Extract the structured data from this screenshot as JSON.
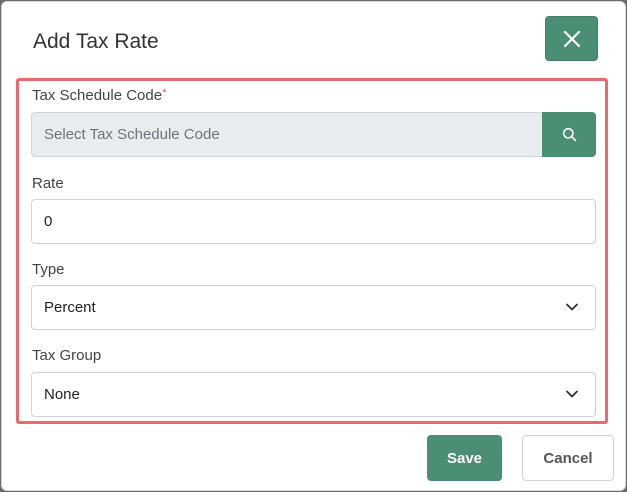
{
  "modal": {
    "title": "Add Tax Rate"
  },
  "form": {
    "tax_schedule": {
      "label": "Tax Schedule Code",
      "required_mark": "*",
      "placeholder": "Select Tax Schedule Code"
    },
    "rate": {
      "label": "Rate",
      "value": "0"
    },
    "type": {
      "label": "Type",
      "selected": "Percent"
    },
    "tax_group": {
      "label": "Tax Group",
      "selected": "None"
    }
  },
  "footer": {
    "save_label": "Save",
    "cancel_label": "Cancel"
  },
  "colors": {
    "accent": "#4a8f73",
    "highlight": "#e86a6e",
    "required": "#d9534f"
  },
  "icons": {
    "close": "close-icon",
    "search": "search-icon",
    "chevron": "chevron-down-icon"
  }
}
